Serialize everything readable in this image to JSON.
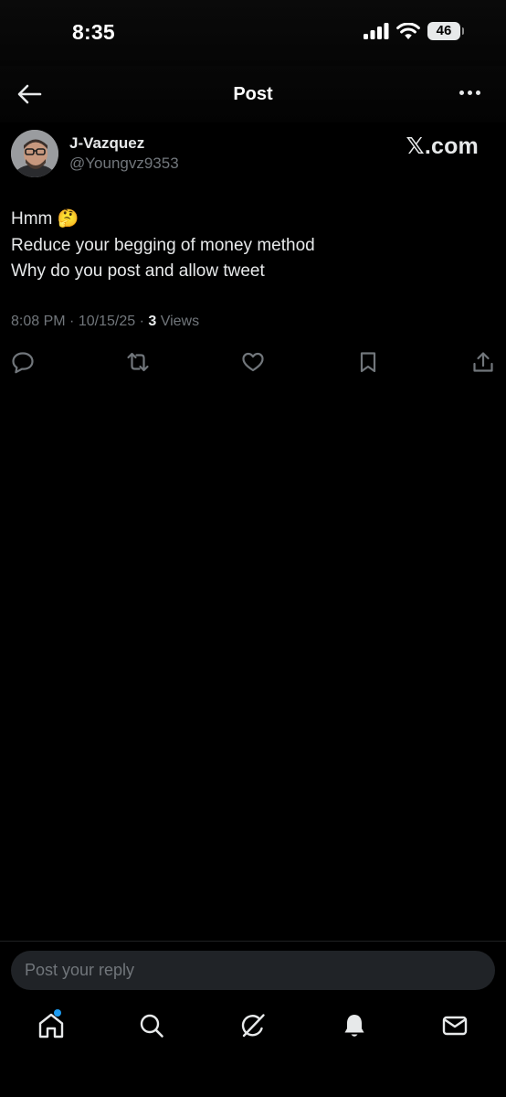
{
  "status_bar": {
    "time": "8:35",
    "battery_level": "46",
    "icons": [
      "cellular-signal-icon",
      "wifi-icon",
      "battery-icon"
    ]
  },
  "nav": {
    "title": "Post",
    "back_icon": "back-arrow-icon",
    "more_icon": "more-icon"
  },
  "post": {
    "author_name": "J-Vazquez",
    "author_handle": "@Youngvz9353",
    "watermark": "𝕏.com",
    "lines": [
      "Hmm 🤔",
      "Reduce your begging of money method",
      "Why do you post and allow tweet"
    ],
    "meta": {
      "time": "8:08 PM",
      "date": "10/15/25",
      "views_count": "3",
      "views_label": "Views",
      "separator": "·"
    },
    "actions": [
      "reply-icon",
      "repost-icon",
      "like-icon",
      "bookmark-icon",
      "share-icon"
    ]
  },
  "reply": {
    "placeholder": "Post your reply"
  },
  "tab_bar": {
    "tabs": [
      "home-icon",
      "search-icon",
      "grok-icon",
      "notifications-icon",
      "messages-icon"
    ],
    "home_has_notification_dot": true,
    "accent": "#1d9bf0"
  },
  "colors": {
    "background": "#000000",
    "primary_text": "#e7e9ea",
    "secondary_text": "#71767b"
  }
}
